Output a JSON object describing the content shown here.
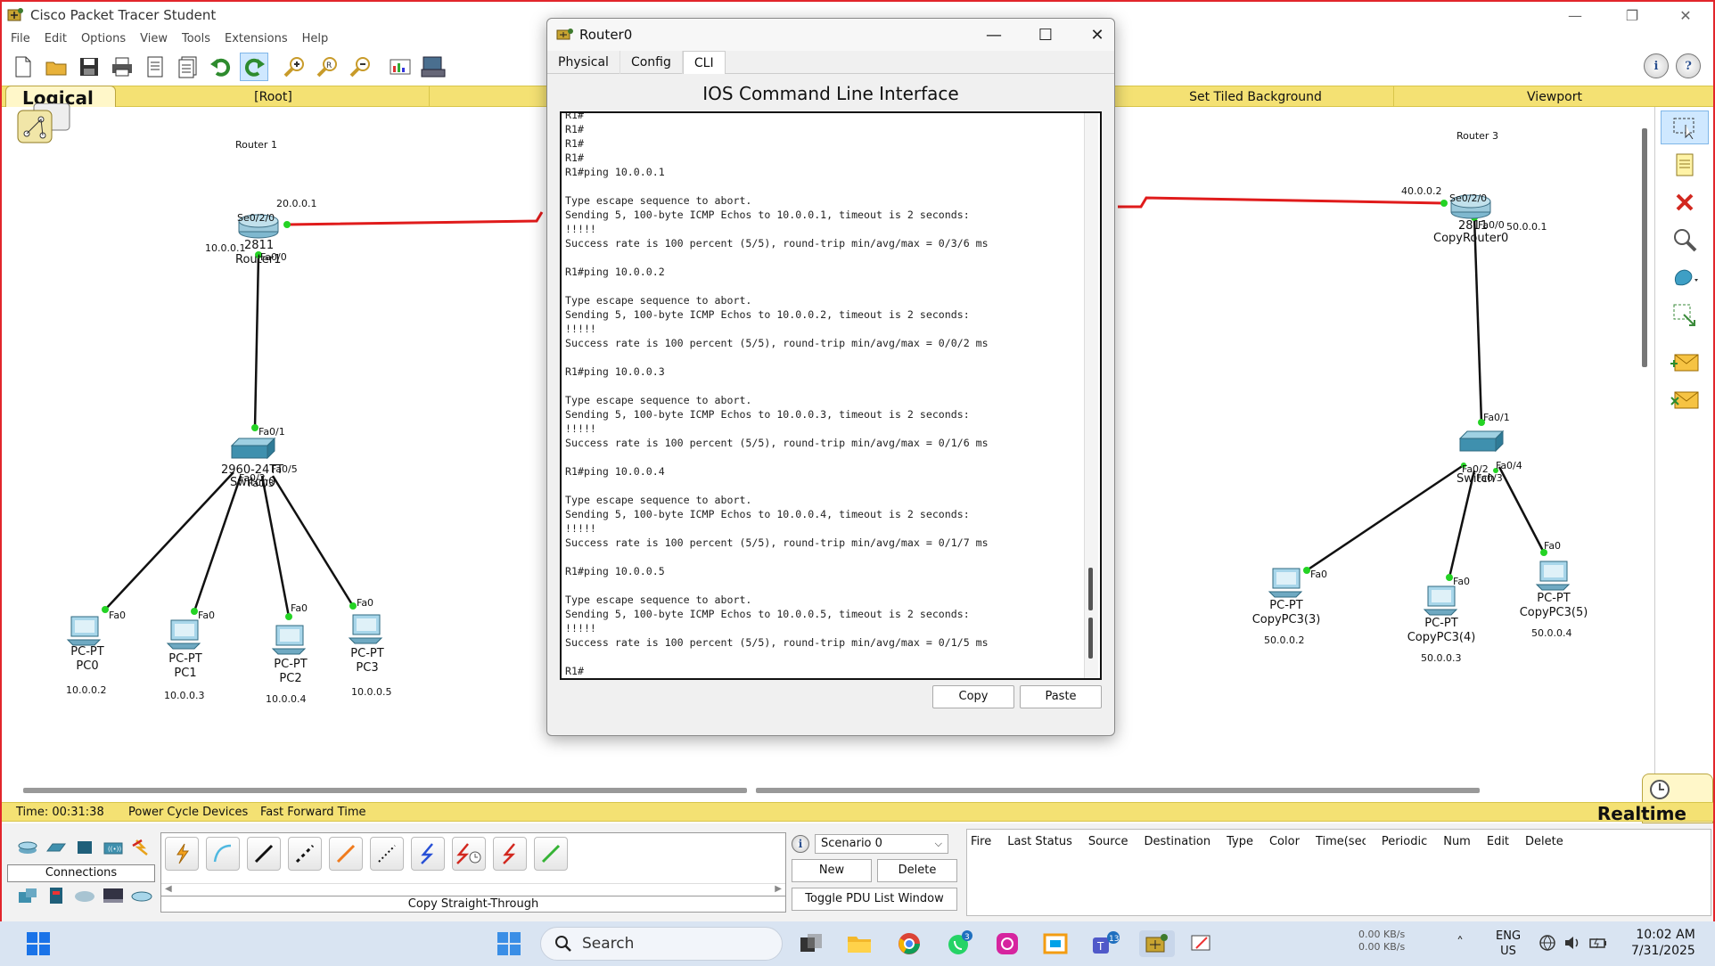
{
  "app": {
    "title": "Cisco Packet Tracer Student",
    "menu": [
      "File",
      "Edit",
      "Options",
      "View",
      "Tools",
      "Extensions",
      "Help"
    ]
  },
  "navbar": {
    "logical": "Logical",
    "root": "[Root]",
    "tiled_bg": "Set Tiled Background",
    "viewport": "Viewport"
  },
  "topology": {
    "router1_caption": "Router 1",
    "router1_model": "2811",
    "router1_name": "Router1",
    "router1_se": "Se0/2/0",
    "router1_fa": "Fa0/0",
    "router1_ip_serial": "20.0.0.1",
    "router1_ip_lan": "10.0.0.1",
    "switch1_model": "2960-24TT",
    "switch1_name": "Switch0",
    "switch1_ports": {
      "up": "Fa0/1",
      "p5": "Fa0/5",
      "p2": "Fa0/2",
      "p3": "Fa0/3"
    },
    "left_pcs": [
      {
        "type": "PC-PT",
        "name": "PC0",
        "ip": "10.0.0.2",
        "port": "Fa0"
      },
      {
        "type": "PC-PT",
        "name": "PC1",
        "ip": "10.0.0.3",
        "port": "Fa0"
      },
      {
        "type": "PC-PT",
        "name": "PC2",
        "ip": "10.0.0.4",
        "port": "Fa0"
      },
      {
        "type": "PC-PT",
        "name": "PC3",
        "ip": "10.0.0.5",
        "port": "Fa0"
      }
    ],
    "router3_caption": "Router 3",
    "router3_model": "2811",
    "router3_name": "CopyRouter0",
    "router3_se": "Se0/2/0",
    "router3_fa": "Fa0/0",
    "router3_ip_serial": "40.0.0.2",
    "router3_ip_lan": "50.0.0.1",
    "switch3_name": "Switch",
    "switch3_ports": {
      "up": "Fa0/1",
      "p2": "Fa0/2",
      "p3": "Fa0/3",
      "p4": "Fa0/4"
    },
    "right_pcs": [
      {
        "type": "PC-PT",
        "name": "CopyPC3(3)",
        "ip": "50.0.0.2",
        "port": "Fa0"
      },
      {
        "type": "PC-PT",
        "name": "CopyPC3(4)",
        "ip": "50.0.0.3",
        "port": "Fa0"
      },
      {
        "type": "PC-PT",
        "name": "CopyPC3(5)",
        "ip": "50.0.0.4",
        "port": "Fa0"
      }
    ]
  },
  "status": {
    "time": "Time: 00:31:38",
    "power_cycle": "Power Cycle Devices",
    "fast_forward": "Fast Forward Time",
    "mode": "Realtime"
  },
  "bottom": {
    "connections_label": "Connections",
    "cable_name": "Copy Straight-Through",
    "scenario": "Scenario 0",
    "new_btn": "New",
    "delete_btn": "Delete",
    "toggle_btn": "Toggle PDU List Window",
    "pdu_columns": [
      "Fire",
      "Last Status",
      "Source",
      "Destination",
      "Type",
      "Color",
      "Time(sec)",
      "Periodic",
      "Num",
      "Edit",
      "Delete"
    ]
  },
  "taskbar": {
    "search_placeholder": "Search",
    "whatsapp_badge": "3",
    "teams_badge": "13",
    "net_up": "0.00 KB/s",
    "net_down": "0.00 KB/s",
    "lang1": "ENG",
    "lang2": "US",
    "clock_time": "10:02 AM",
    "clock_date": "7/31/2025"
  },
  "dialog": {
    "title": "Router0",
    "tabs": [
      "Physical",
      "Config",
      "CLI"
    ],
    "active_tab": "CLI",
    "heading": "IOS Command Line Interface",
    "cli_text": "R1#\nR1#\nR1#\nR1#\nR1#ping 10.0.0.1\n\nType escape sequence to abort.\nSending 5, 100-byte ICMP Echos to 10.0.0.1, timeout is 2 seconds:\n!!!!!\nSuccess rate is 100 percent (5/5), round-trip min/avg/max = 0/3/6 ms\n\nR1#ping 10.0.0.2\n\nType escape sequence to abort.\nSending 5, 100-byte ICMP Echos to 10.0.0.2, timeout is 2 seconds:\n!!!!!\nSuccess rate is 100 percent (5/5), round-trip min/avg/max = 0/0/2 ms\n\nR1#ping 10.0.0.3\n\nType escape sequence to abort.\nSending 5, 100-byte ICMP Echos to 10.0.0.3, timeout is 2 seconds:\n!!!!!\nSuccess rate is 100 percent (5/5), round-trip min/avg/max = 0/1/6 ms\n\nR1#ping 10.0.0.4\n\nType escape sequence to abort.\nSending 5, 100-byte ICMP Echos to 10.0.0.4, timeout is 2 seconds:\n!!!!!\nSuccess rate is 100 percent (5/5), round-trip min/avg/max = 0/1/7 ms\n\nR1#ping 10.0.0.5\n\nType escape sequence to abort.\nSending 5, 100-byte ICMP Echos to 10.0.0.5, timeout is 2 seconds:\n!!!!!\nSuccess rate is 100 percent (5/5), round-trip min/avg/max = 0/1/5 ms\n\nR1#",
    "copy_btn": "Copy",
    "paste_btn": "Paste"
  }
}
